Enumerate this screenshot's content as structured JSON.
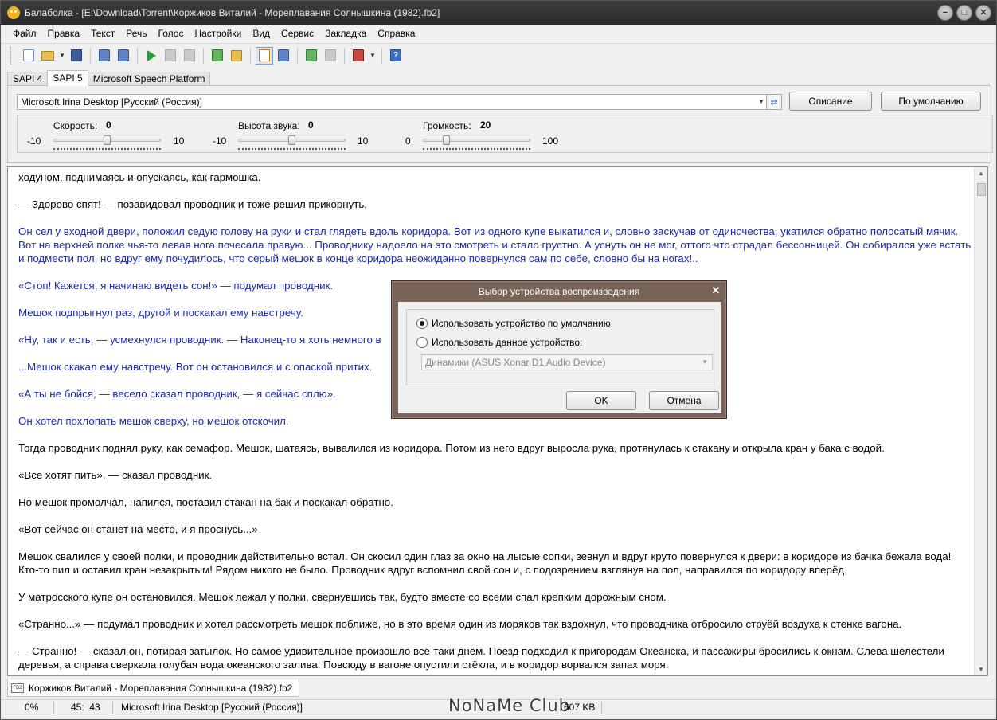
{
  "window": {
    "title": "Балаболка - [E:\\Download\\Torrent\\Коржиков Виталий - Мореплавания Солнышкина (1982).fb2]",
    "buttons": {
      "minimize": "−",
      "maximize": "□",
      "close": "✕"
    }
  },
  "menu": [
    "Файл",
    "Правка",
    "Текст",
    "Речь",
    "Голос",
    "Настройки",
    "Вид",
    "Сервис",
    "Закладка",
    "Справка"
  ],
  "toolbar": {
    "icons": [
      "new-document-icon",
      "open-folder-icon",
      "save-icon",
      "convert-icon",
      "batch-convert-icon",
      "play-icon",
      "pause-icon",
      "stop-icon",
      "split-icon",
      "bookmark-icon",
      "clipboard-icon",
      "dictionary-icon",
      "voice-icon",
      "voice-gray-icon",
      "export-icon",
      "help-icon"
    ]
  },
  "tabs": [
    "SAPI 4",
    "SAPI 5",
    "Microsoft Speech Platform"
  ],
  "selected_tab": "SAPI 5",
  "voice": {
    "selected": "Microsoft Irina Desktop [Русский (Россия)]",
    "description_button": "Описание",
    "default_button": "По умолчанию"
  },
  "sliders": {
    "rate": {
      "label": "Скорость:",
      "value": "0",
      "min": "-10",
      "max": "10",
      "fraction": 0.5
    },
    "pitch": {
      "label": "Высота звука:",
      "value": "0",
      "min": "-10",
      "max": "10",
      "fraction": 0.5
    },
    "volume": {
      "label": "Громкость:",
      "value": "20",
      "min": "0",
      "max": "100",
      "fraction": 0.2
    }
  },
  "text": {
    "p1": "ходуном, поднимаясь и опускаясь, как гармошка.",
    "p2": "— Здорово спят! — позавидовал проводник и тоже решил прикорнуть.",
    "p3": "Он сел у входной двери, положил седую голову на руки и стал глядеть вдоль коридора. Вот из одного купе выкатился и, словно заскучав от одиночества, укатился обратно полосатый мячик. Вот на верхней полке чья-то левая нога почесала правую... Проводнику надоело на это смотреть и стало грустно. А уснуть он не мог, оттого что страдал бессонницей. Он собирался уже встать и подмести пол, но вдруг ему почудилось, что серый мешок в конце коридора неожиданно повернулся сам по себе, словно бы на ногах!..",
    "p4": "«Стоп! Кажется, я начинаю видеть сон!» — подумал проводник.",
    "p5": "Мешок подпрыгнул раз, другой и поскакал ему навстречу.",
    "p6": "«Ну, так и есть, — усмехнулся проводник. — Наконец-то я хоть немного в",
    "p7": "...Мешок скакал ему навстречу. Вот он остановился и с опаской притих.",
    "p8": "«А ты не бойся, — весело сказал проводник, — я сейчас сплю».",
    "p9": "Он хотел похлопать мешок сверху, но мешок отскочил.",
    "p10": "Тогда проводник поднял руку, как семафор. Мешок, шатаясь, вывалился из коридора. Потом из него вдруг выросла рука, протянулась к стакану и открыла кран у бака с водой.",
    "p11": "«Все хотят пить», — сказал проводник.",
    "p12": "Но мешок промолчал, напился, поставил стакан на бак и поскакал обратно.",
    "p13": "«Вот сейчас он станет на место, и я проснусь...»",
    "p14": "Мешок свалился у своей полки, и проводник действительно встал. Он скосил один глаз за окно на лысые сопки, зевнул и вдруг круто повернулся к двери: в коридоре из бачка бежала вода! Кто-то пил и оставил кран незакрытым! Рядом никого не было. Проводник вдруг вспомнил свой сон и, с подозрением взглянув на пол, направился по коридору вперёд.",
    "p15": "У матросского купе он остановился. Мешок лежал у полки, свернувшись так, будто вместе со всеми спал крепким дорожным сном.",
    "p16": "«Странно...» — подумал проводник и хотел рассмотреть мешок поближе, но в это время один из моряков так вздохнул, что проводника отбросило струёй воздуха к стенке вагона.",
    "p17": "— Странно! — сказал он, потирая затылок. Но самое удивительное произошло всё-таки днём. Поезд подходил к пригородам Океанска, и пассажиры бросились к окнам. Слева шелестели деревья, а справа сверкала голубая вода океанского залива. Повсюду в вагоне опустили стёкла, и в коридор ворвался запах моря."
  },
  "doc_tab": {
    "icon_label": "FB2",
    "name": "Коржиков Виталий - Мореплавания Солнышкина (1982).fb2"
  },
  "status": {
    "progress": "0%",
    "position": "45:  43",
    "voice": "Microsoft Irina Desktop [Русский (Россия)]",
    "watermark": "NoNaMe Club",
    "size": "607 KB"
  },
  "dialog": {
    "title": "Выбор устройства воспроизведения",
    "option_default": "Использовать устройство по умолчанию",
    "option_device": "Использовать данное устройство:",
    "device": "Динамики (ASUS Xonar D1 Audio Device)",
    "ok": "OK",
    "cancel": "Отмена"
  },
  "colors": {
    "blue_text": "#1e2aa6",
    "titlebar": "#2b2c2e",
    "dialog_frame": "#7a6458"
  }
}
